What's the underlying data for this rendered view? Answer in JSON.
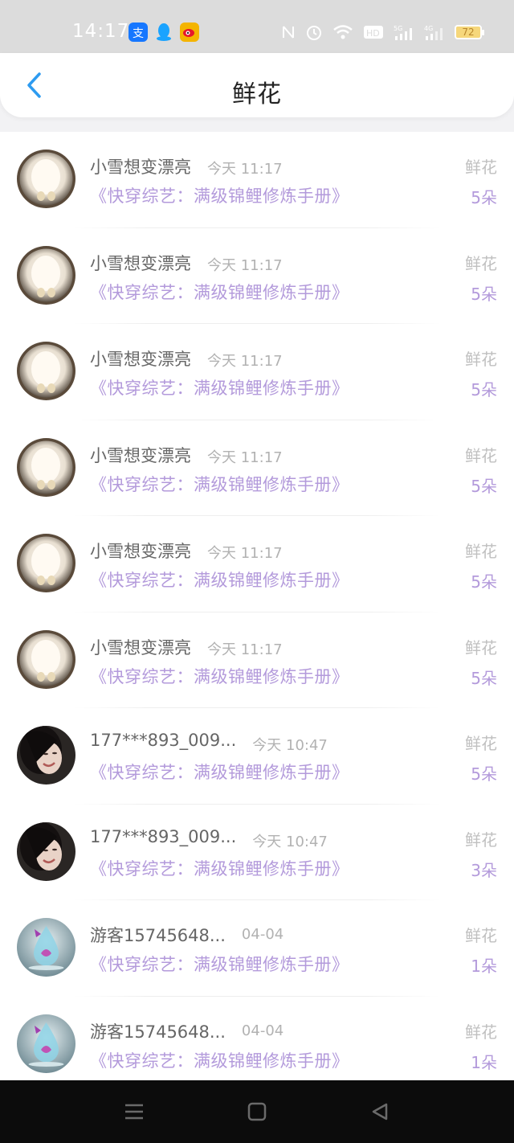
{
  "status_bar": {
    "time": "14:17",
    "app_icons": [
      "alipay-icon",
      "qq-icon",
      "weibo-icon"
    ],
    "sys_icons": [
      "nfc-icon",
      "alarm-icon",
      "wifi-icon",
      "hd-icon",
      "signal-5g-icon",
      "signal-4g-icon"
    ],
    "battery": "72"
  },
  "header": {
    "back_icon": "chevron-left-icon",
    "title": "鲜花"
  },
  "list": [
    {
      "avatar": "avatar-bunny",
      "name": "小雪想变漂亮",
      "time": "今天 11:17",
      "book": "《快穿综艺：满级锦鲤修炼手册》",
      "gift": "鲜花",
      "count": "5朵"
    },
    {
      "avatar": "avatar-bunny",
      "name": "小雪想变漂亮",
      "time": "今天 11:17",
      "book": "《快穿综艺：满级锦鲤修炼手册》",
      "gift": "鲜花",
      "count": "5朵"
    },
    {
      "avatar": "avatar-bunny",
      "name": "小雪想变漂亮",
      "time": "今天 11:17",
      "book": "《快穿综艺：满级锦鲤修炼手册》",
      "gift": "鲜花",
      "count": "5朵"
    },
    {
      "avatar": "avatar-bunny",
      "name": "小雪想变漂亮",
      "time": "今天 11:17",
      "book": "《快穿综艺：满级锦鲤修炼手册》",
      "gift": "鲜花",
      "count": "5朵"
    },
    {
      "avatar": "avatar-bunny",
      "name": "小雪想变漂亮",
      "time": "今天 11:17",
      "book": "《快穿综艺：满级锦鲤修炼手册》",
      "gift": "鲜花",
      "count": "5朵"
    },
    {
      "avatar": "avatar-bunny",
      "name": "小雪想变漂亮",
      "time": "今天 11:17",
      "book": "《快穿综艺：满级锦鲤修炼手册》",
      "gift": "鲜花",
      "count": "5朵"
    },
    {
      "avatar": "avatar-girl",
      "name": "177***893_009...",
      "time": "今天 10:47",
      "book": "《快穿综艺：满级锦鲤修炼手册》",
      "gift": "鲜花",
      "count": "5朵"
    },
    {
      "avatar": "avatar-girl",
      "name": "177***893_009...",
      "time": "今天 10:47",
      "book": "《快穿综艺：满级锦鲤修炼手册》",
      "gift": "鲜花",
      "count": "3朵"
    },
    {
      "avatar": "avatar-water-drop",
      "name": "游客15745648...",
      "time": "04-04",
      "book": "《快穿综艺：满级锦鲤修炼手册》",
      "gift": "鲜花",
      "count": "1朵"
    },
    {
      "avatar": "avatar-water-drop",
      "name": "游客15745648...",
      "time": "04-04",
      "book": "《快穿综艺：满级锦鲤修炼手册》",
      "gift": "鲜花",
      "count": "1朵"
    }
  ],
  "bottom_nav": [
    "menu-icon",
    "home-square-icon",
    "back-triangle-icon"
  ]
}
